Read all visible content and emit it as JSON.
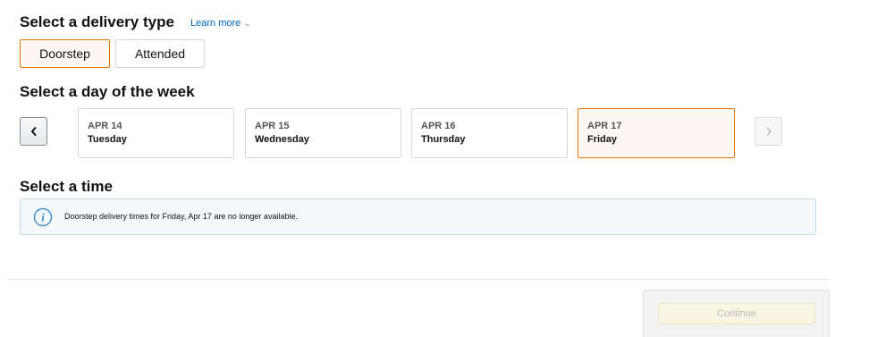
{
  "delivery_type": {
    "heading": "Select a delivery type",
    "learn_more": "Learn more",
    "chevron": "⌄",
    "options": [
      {
        "label": "Doorstep",
        "selected": true
      },
      {
        "label": "Attended",
        "selected": false
      }
    ]
  },
  "day_picker": {
    "heading": "Select a day of the week",
    "prev_icon": "chevron-left-icon",
    "next_icon": "chevron-right-icon",
    "days": [
      {
        "date": "APR 14",
        "weekday": "Tuesday",
        "selected": false
      },
      {
        "date": "APR 15",
        "weekday": "Wednesday",
        "selected": false
      },
      {
        "date": "APR 16",
        "weekday": "Thursday",
        "selected": false
      },
      {
        "date": "APR 17",
        "weekday": "Friday",
        "selected": true
      }
    ]
  },
  "time": {
    "heading": "Select a time",
    "info_icon": "info-icon",
    "message": "Doorstep delivery times for Friday, Apr 17 are no longer available."
  },
  "footer": {
    "continue_label": "Continue",
    "continue_enabled": false
  },
  "colors": {
    "accent_orange": "#e77600",
    "selected_bg": "#fef8f2",
    "link_blue": "#0066c0",
    "info_icon_blue": "#3b8ed0",
    "info_bg": "#f4f8fa",
    "continue_disabled_bg": "#f9f5e3"
  }
}
